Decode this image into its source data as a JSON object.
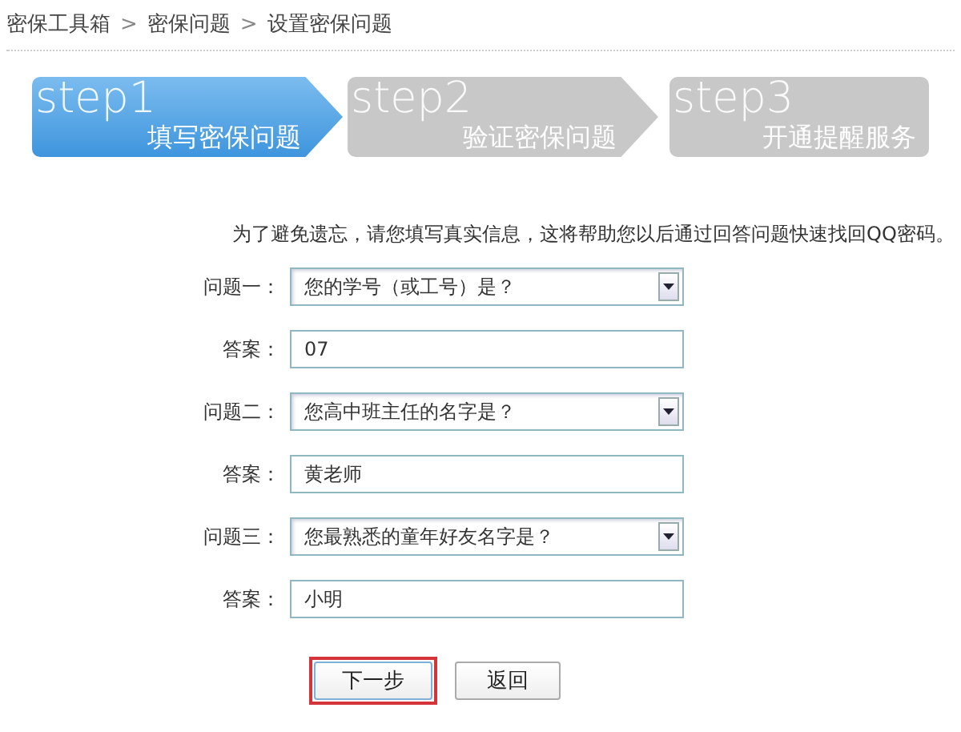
{
  "breadcrumb": [
    {
      "label": "密保工具箱"
    },
    {
      "label": "密保问题"
    },
    {
      "label": "设置密保问题"
    }
  ],
  "separator": ">",
  "steps": [
    {
      "number": "step1",
      "label": "填写密保问题",
      "selected": true
    },
    {
      "number": "step2",
      "label": "验证密保问题",
      "selected": false
    },
    {
      "number": "step3",
      "label": "开通提醒服务",
      "selected": false
    }
  ],
  "intro": "为了避免遗忘，请您填写真实信息，这将帮助您以后通过回答问题快速找回QQ密码。",
  "rows": [
    {
      "kind": "select",
      "label": "问题一：",
      "value": "您的学号（或工号）是？"
    },
    {
      "kind": "input",
      "label": "答案：",
      "value": "07"
    },
    {
      "kind": "select",
      "label": "问题二：",
      "value": "您高中班主任的名字是？"
    },
    {
      "kind": "input",
      "label": "答案：",
      "value": "黄老师"
    },
    {
      "kind": "select",
      "label": "问题三：",
      "value": "您最熟悉的童年好友名字是？"
    },
    {
      "kind": "input",
      "label": "答案：",
      "value": "小明"
    }
  ],
  "buttons": [
    {
      "label": "下一步",
      "highlighted": true
    },
    {
      "label": "返回",
      "highlighted": false
    }
  ]
}
